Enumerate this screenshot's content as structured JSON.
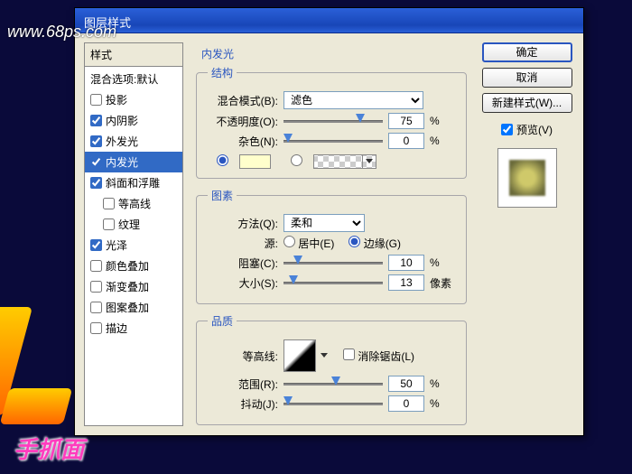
{
  "watermark": {
    "top": "www.68ps.com",
    "bottom": "手抓面"
  },
  "titlebar": "图层样式",
  "styles": {
    "header": "样式",
    "items": [
      {
        "label": "混合选项:默认",
        "checked": null,
        "selected": false,
        "indent": false
      },
      {
        "label": "投影",
        "checked": false,
        "selected": false,
        "indent": false
      },
      {
        "label": "内阴影",
        "checked": true,
        "selected": false,
        "indent": false
      },
      {
        "label": "外发光",
        "checked": true,
        "selected": false,
        "indent": false
      },
      {
        "label": "内发光",
        "checked": true,
        "selected": true,
        "indent": false
      },
      {
        "label": "斜面和浮雕",
        "checked": true,
        "selected": false,
        "indent": false
      },
      {
        "label": "等高线",
        "checked": false,
        "selected": false,
        "indent": true
      },
      {
        "label": "纹理",
        "checked": false,
        "selected": false,
        "indent": true
      },
      {
        "label": "光泽",
        "checked": true,
        "selected": false,
        "indent": false
      },
      {
        "label": "颜色叠加",
        "checked": false,
        "selected": false,
        "indent": false
      },
      {
        "label": "渐变叠加",
        "checked": false,
        "selected": false,
        "indent": false
      },
      {
        "label": "图案叠加",
        "checked": false,
        "selected": false,
        "indent": false
      },
      {
        "label": "描边",
        "checked": false,
        "selected": false,
        "indent": false
      }
    ]
  },
  "main": {
    "title": "内发光",
    "structure": {
      "legend": "结构",
      "blendMode": {
        "label": "混合模式(B):",
        "value": "滤色"
      },
      "opacity": {
        "label": "不透明度(O):",
        "value": "75",
        "unit": "%",
        "pos": 73
      },
      "noise": {
        "label": "杂色(N):",
        "value": "0",
        "unit": "%",
        "pos": 0
      }
    },
    "elements": {
      "legend": "图素",
      "technique": {
        "label": "方法(Q):",
        "value": "柔和"
      },
      "source": {
        "label": "源:",
        "center": "居中(E)",
        "edge": "边缘(G)",
        "selected": "edge"
      },
      "choke": {
        "label": "阻塞(C):",
        "value": "10",
        "unit": "%",
        "pos": 10
      },
      "size": {
        "label": "大小(S):",
        "value": "13",
        "unit": "像素",
        "pos": 5
      }
    },
    "quality": {
      "legend": "品质",
      "contour": {
        "label": "等高线:",
        "antialias": "消除锯齿(L)"
      },
      "range": {
        "label": "范围(R):",
        "value": "50",
        "unit": "%",
        "pos": 48
      },
      "jitter": {
        "label": "抖动(J):",
        "value": "0",
        "unit": "%",
        "pos": 0
      }
    }
  },
  "buttons": {
    "ok": "确定",
    "cancel": "取消",
    "newStyle": "新建样式(W)...",
    "preview": "预览(V)"
  }
}
